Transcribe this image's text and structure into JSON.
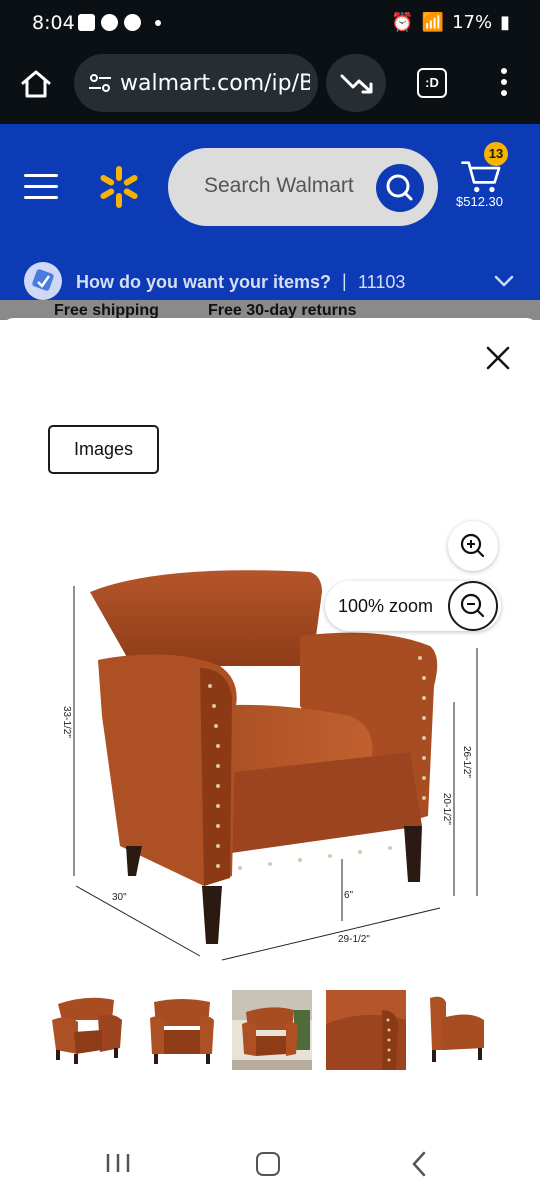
{
  "status_bar": {
    "time": "8:04",
    "battery": "17%"
  },
  "browser": {
    "url": "walmart.com/ip/B",
    "tab_label": ":D"
  },
  "header": {
    "search_placeholder": "Search Walmart",
    "cart_count": "13",
    "cart_total": "$512.30"
  },
  "fulfillment": {
    "question": "How do you want your items?",
    "separator": "|",
    "zip": "11103"
  },
  "peek": {
    "left": "Free shipping",
    "right": "Free 30-day returns"
  },
  "viewer": {
    "tab_label": "Images",
    "zoom_label": "100% zoom",
    "dimensions": {
      "height_total": "33-1/2\"",
      "height_arm": "26-1/2\"",
      "height_seat": "20-1/2\"",
      "leg": "6\"",
      "depth": "30\"",
      "width": "29-1/2\""
    },
    "thumbnail_count": 5
  },
  "colors": {
    "walmart_blue": "#0d3ab5",
    "spark_yellow": "#f6b400",
    "leather": "#a0461e"
  },
  "icons": [
    "home-icon",
    "tune-icon",
    "trending-down-icon",
    "tab-switcher-icon",
    "more-vert-icon",
    "hamburger-icon",
    "walmart-spark-icon",
    "search-icon",
    "cart-icon",
    "location-icon",
    "chevron-down-icon",
    "close-icon",
    "zoom-in-icon",
    "zoom-out-icon"
  ]
}
